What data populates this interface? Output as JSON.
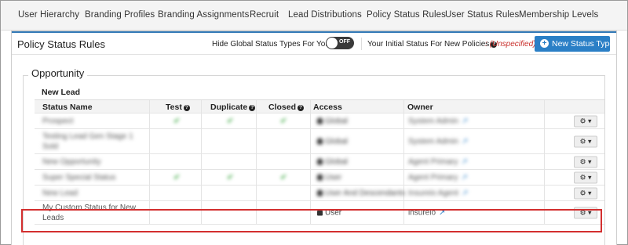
{
  "nav": {
    "tabs": [
      "User Hierarchy",
      "Branding Profiles",
      "Branding Assignments",
      "Recruit",
      "Lead Distributions",
      "Policy Status Rules",
      "User Status Rules",
      "Membership Levels"
    ]
  },
  "header": {
    "title": "Policy Status Rules",
    "hide_global_label": "Hide Global Status Types For You?",
    "toggle_state": "OFF",
    "initial_status_label": "Your Initial Status For New Policies",
    "initial_status_value": ": (Unspecified)",
    "new_button_label": "New Status Type",
    "accent_color": "#2a7fc6"
  },
  "section": {
    "legend": "Opportunity",
    "group_title": "New Lead",
    "columns": [
      "Status Name",
      "Test",
      "Duplicate",
      "Closed",
      "Access",
      "Owner",
      ""
    ],
    "rows": [
      {
        "name": "Prospect",
        "test": "✔",
        "duplicate": "✔",
        "closed": "✔",
        "access": "Global",
        "owner": "System Admin",
        "blurred": true
      },
      {
        "name": "Testing Lead Gen Stage 1 Sold",
        "test": "",
        "duplicate": "",
        "closed": "",
        "access": "Global",
        "owner": "System Admin",
        "blurred": true
      },
      {
        "name": "New Opportunity",
        "test": "",
        "duplicate": "",
        "closed": "",
        "access": "Global",
        "owner": "Agent Primary",
        "blurred": true
      },
      {
        "name": "Super Special Status",
        "test": "✔",
        "duplicate": "✔",
        "closed": "✔",
        "access": "User",
        "owner": "Agent Primary",
        "blurred": true
      },
      {
        "name": "New Lead",
        "test": "",
        "duplicate": "",
        "closed": "",
        "access": "User And Descendants",
        "owner": "Insureio Agent",
        "blurred": true
      },
      {
        "name": "My Custom Status for New Leads",
        "test": "",
        "duplicate": "",
        "closed": "",
        "access": "User",
        "owner": "insureio",
        "blurred": false
      }
    ]
  },
  "icons": {
    "help": "question-circle-icon",
    "external": "external-link-icon",
    "gear": "gear-icon",
    "user": "user-icon",
    "plus": "plus-circle-icon"
  }
}
